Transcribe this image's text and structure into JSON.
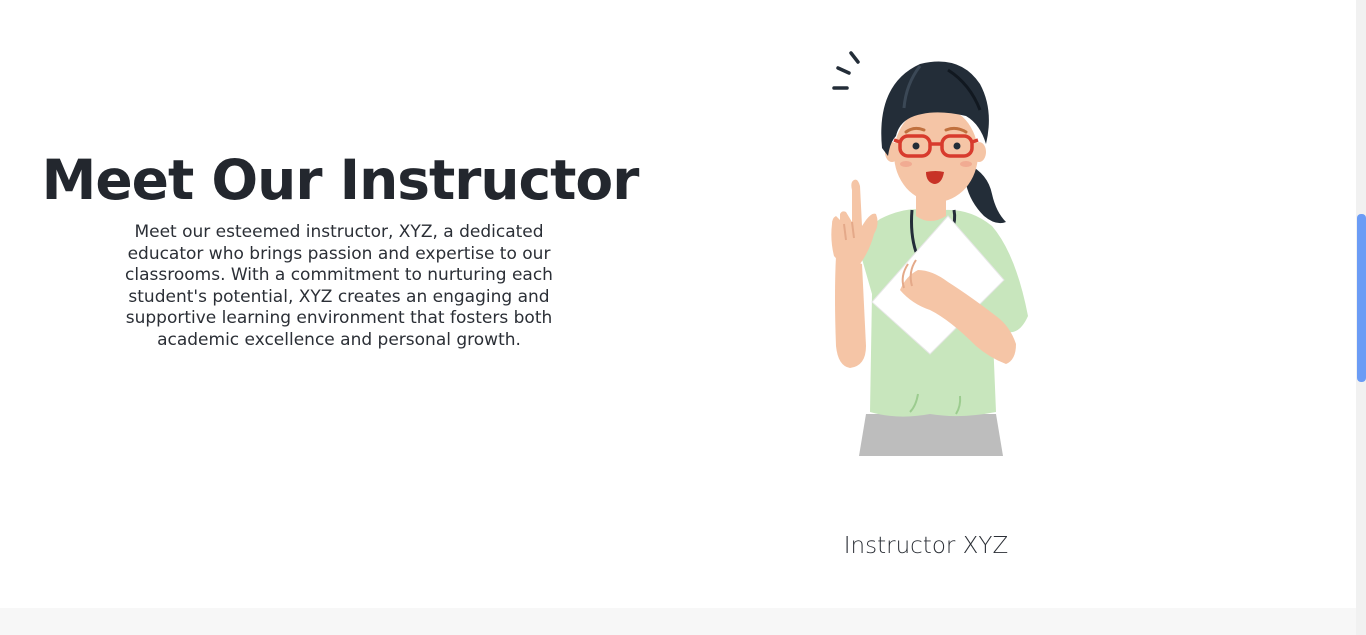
{
  "section": {
    "heading": "Meet Our Instructor",
    "description": "Meet our esteemed instructor, XYZ, a dedicated educator who brings passion and expertise to our classrooms. With a commitment to nurturing each student's potential, XYZ creates an engaging and supportive learning environment that fosters both academic excellence and personal growth.",
    "caption": "Instructor XYZ"
  },
  "colors": {
    "text": "#23272e",
    "shirt": "#c8e6bd",
    "skirt": "#bdbdbd",
    "hair": "#232d38",
    "skin": "#f5c5a6",
    "glasses": "#d83b2d",
    "scrollbar_thumb": "#6b9cf5"
  }
}
